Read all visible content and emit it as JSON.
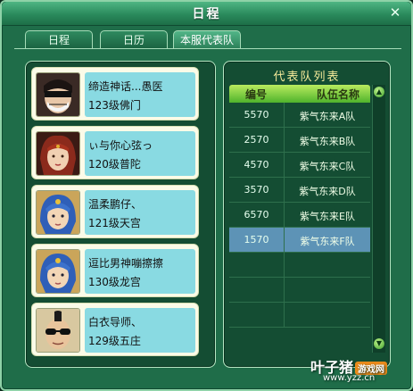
{
  "window": {
    "title": "日程",
    "close_symbol": "✕"
  },
  "tabs": [
    {
      "label": "日程",
      "active": false
    },
    {
      "label": "日历",
      "active": false
    },
    {
      "label": "本服代表队",
      "active": true
    }
  ],
  "players": [
    {
      "name": "缔造神话...愚医",
      "level": "123级佛门",
      "avatar": "masked-avatar"
    },
    {
      "name": "ぃ与你心弦っ",
      "level": "120级普陀",
      "avatar": "red-hair-avatar"
    },
    {
      "name": "温柔鹏仔、",
      "level": "121级天宫",
      "avatar": "blue-hair-avatar"
    },
    {
      "name": "逗比男神嘣擦擦",
      "level": "130级龙宫",
      "avatar": "blue-hair-avatar"
    },
    {
      "name": "白衣导师、",
      "level": "129级五庄",
      "avatar": "sunglasses-avatar"
    }
  ],
  "team_list": {
    "title": "代表队列表",
    "headers": [
      "编号",
      "队伍名称"
    ],
    "rows": [
      {
        "code": "5570",
        "name": "紫气东来A队",
        "selected": false
      },
      {
        "code": "2570",
        "name": "紫气东来B队",
        "selected": false
      },
      {
        "code": "4570",
        "name": "紫气东来C队",
        "selected": false
      },
      {
        "code": "3570",
        "name": "紫气东来D队",
        "selected": false
      },
      {
        "code": "6570",
        "name": "紫气东来E队",
        "selected": false
      },
      {
        "code": "1570",
        "name": "紫气东来F队",
        "selected": true
      }
    ],
    "empty_rows": 3
  },
  "watermark": {
    "text": "叶子猪",
    "badge": "游戏网",
    "url": "www.yzz.cn"
  },
  "colors": {
    "window_bg": "#1f6d49",
    "card_info_bg": "#89dae2",
    "selected_row": "#5d93b6",
    "header_green": "#4fb32c",
    "list_title": "#f4ea9a"
  }
}
